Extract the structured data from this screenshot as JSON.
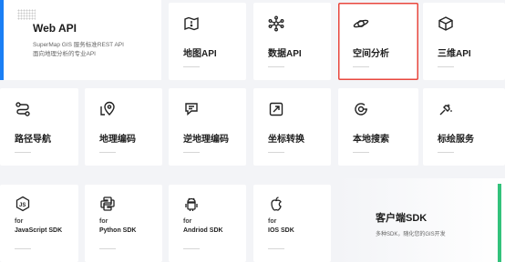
{
  "hero": {
    "title": "Web API",
    "desc_line1": "SuperMap GIS 服务标准REST API",
    "desc_line2": "面向地理分析的专业API"
  },
  "row1": [
    {
      "label": "地图API",
      "icon": "map-icon"
    },
    {
      "label": "数据API",
      "icon": "data-network-icon"
    },
    {
      "label": "空间分析",
      "icon": "orbit-icon",
      "selected": true
    },
    {
      "label": "三维API",
      "icon": "cube-icon"
    }
  ],
  "row2": [
    {
      "label": "路径导航",
      "icon": "route-icon"
    },
    {
      "label": "地理编码",
      "icon": "location-pin-icon"
    },
    {
      "label": "逆地理编码",
      "icon": "reverse-geocode-icon"
    },
    {
      "label": "坐标转换",
      "icon": "coordinate-transform-icon"
    },
    {
      "label": "本地搜索",
      "icon": "local-search-icon"
    },
    {
      "label": "标绘服务",
      "icon": "plot-icon"
    }
  ],
  "row3": [
    {
      "for": "for",
      "name": "JavaScript SDK",
      "icon": "javascript-icon"
    },
    {
      "for": "for",
      "name": "Python SDK",
      "icon": "python-icon"
    },
    {
      "for": "for",
      "name": "Andriod SDK",
      "icon": "android-icon"
    },
    {
      "for": "for",
      "name": "IOS SDK",
      "icon": "apple-icon"
    }
  ],
  "client": {
    "title": "客户端SDK",
    "desc": "多种SDK，随化您的GIS开发"
  },
  "colors": {
    "accent_blue": "#1a7ff5",
    "selected_border": "#e8473d",
    "client_bar": "#33c27b"
  }
}
